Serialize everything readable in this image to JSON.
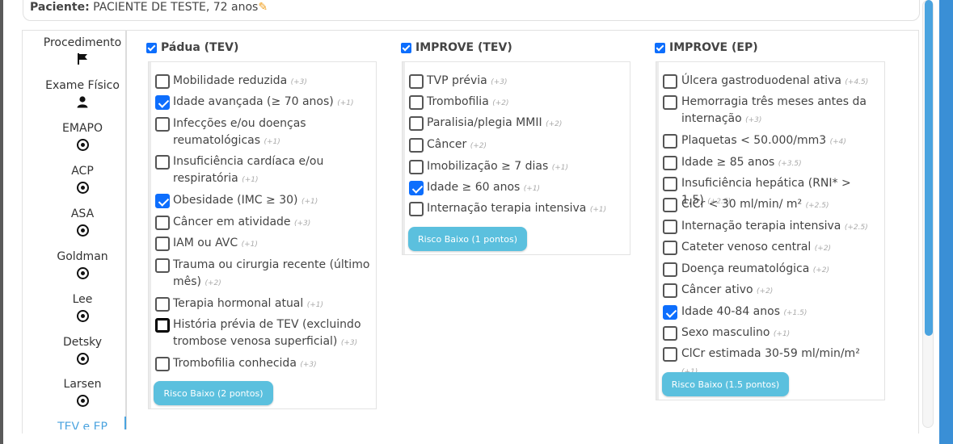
{
  "patient": {
    "label": "Paciente:",
    "value": "PACIENTE DE TESTE, 72 anos"
  },
  "sidebar": {
    "items": [
      {
        "label": "Procedimento",
        "icon": "flag-icon"
      },
      {
        "label": "Exame Físico",
        "icon": "user-icon"
      },
      {
        "label": "EMAPO",
        "icon": "target-icon"
      },
      {
        "label": "ACP",
        "icon": "target-icon"
      },
      {
        "label": "ASA",
        "icon": "target-icon"
      },
      {
        "label": "Goldman",
        "icon": "target-icon"
      },
      {
        "label": "Lee",
        "icon": "target-icon"
      },
      {
        "label": "Detsky",
        "icon": "target-icon"
      },
      {
        "label": "Larsen",
        "icon": "target-icon"
      },
      {
        "label": "TEV e EP",
        "icon": "",
        "active": true
      }
    ]
  },
  "padua": {
    "title": "Pádua (TEV)",
    "risk_button": "Risco Baixo (2 pontos)",
    "items": [
      {
        "label": "Mobilidade reduzida",
        "pts": "(+3)",
        "checked": false
      },
      {
        "label": "Idade avançada (≥ 70 anos)",
        "pts": "(+1)",
        "checked": true
      },
      {
        "label": "Infecções e/ou doenças reumatológicas",
        "pts": "(+1)",
        "checked": false
      },
      {
        "label": "Insuficiência cardíaca e/ou respiratória",
        "pts": "(+1)",
        "checked": false
      },
      {
        "label": "Obesidade (IMC ≥ 30)",
        "pts": "(+1)",
        "checked": true
      },
      {
        "label": "Câncer em atividade",
        "pts": "(+3)",
        "checked": false
      },
      {
        "label": "IAM ou AVC",
        "pts": "(+1)",
        "checked": false
      },
      {
        "label": "Trauma ou cirurgia recente (último mês)",
        "pts": "(+2)",
        "checked": false
      },
      {
        "label": "Terapia hormonal atual",
        "pts": "(+1)",
        "checked": false
      },
      {
        "label": "História prévia de TEV (excluindo trombose venosa superficial)",
        "pts": "(+3)",
        "checked": false,
        "focused": true
      },
      {
        "label": "Trombofilia conhecida",
        "pts": "(+3)",
        "checked": false
      }
    ]
  },
  "improve_tev": {
    "title": "IMPROVE (TEV)",
    "risk_button": "Risco Baixo (1 pontos)",
    "items": [
      {
        "label": "TVP prévia",
        "pts": "(+3)",
        "checked": false
      },
      {
        "label": "Trombofilia",
        "pts": "(+2)",
        "checked": false
      },
      {
        "label": "Paralisia/plegia MMII",
        "pts": "(+2)",
        "checked": false
      },
      {
        "label": "Câncer",
        "pts": "(+2)",
        "checked": false
      },
      {
        "label": "Imobilização ≥ 7 dias",
        "pts": "(+1)",
        "checked": false
      },
      {
        "label": "Idade ≥ 60 anos",
        "pts": "(+1)",
        "checked": true
      },
      {
        "label": "Internação terapia intensiva",
        "pts": "(+1)",
        "checked": false
      }
    ]
  },
  "improve_ep": {
    "title": "IMPROVE (EP)",
    "risk_button": "Risco Baixo (1.5 pontos)",
    "items": [
      {
        "label": "Úlcera gastroduodenal ativa",
        "pts": "(+4.5)",
        "checked": false
      },
      {
        "label": "Hemorragia três meses antes da internação",
        "pts": "(+3)",
        "checked": false
      },
      {
        "label": "Plaquetas < 50.000/mm3",
        "pts": "(+4)",
        "checked": false
      },
      {
        "label": "Idade ≥ 85 anos",
        "pts": "(+3.5)",
        "checked": false
      },
      {
        "label": "Insuficiência hepática (RNI* > 1,5)",
        "pts": "(+2.5)",
        "checked": false
      },
      {
        "label": "ClCr < 30 ml/min/ m²",
        "pts": "(+2.5)",
        "checked": false
      },
      {
        "label": "Internação terapia intensiva",
        "pts": "(+2.5)",
        "checked": false
      },
      {
        "label": "Cateter venoso central",
        "pts": "(+2)",
        "checked": false
      },
      {
        "label": "Doença reumatológica",
        "pts": "(+2)",
        "checked": false
      },
      {
        "label": "Câncer ativo",
        "pts": "(+2)",
        "checked": false
      },
      {
        "label": "Idade 40-84 anos",
        "pts": "(+1.5)",
        "checked": true
      },
      {
        "label": "Sexo masculino",
        "pts": "(+1)",
        "checked": false
      },
      {
        "label": "ClCr estimada 30-59 ml/min/m²",
        "pts": "(+1)",
        "checked": false
      }
    ]
  },
  "colors": {
    "accent": "#0d6efd",
    "risk_button": "#5bc0de",
    "scrollbar": "#4aa3df"
  }
}
